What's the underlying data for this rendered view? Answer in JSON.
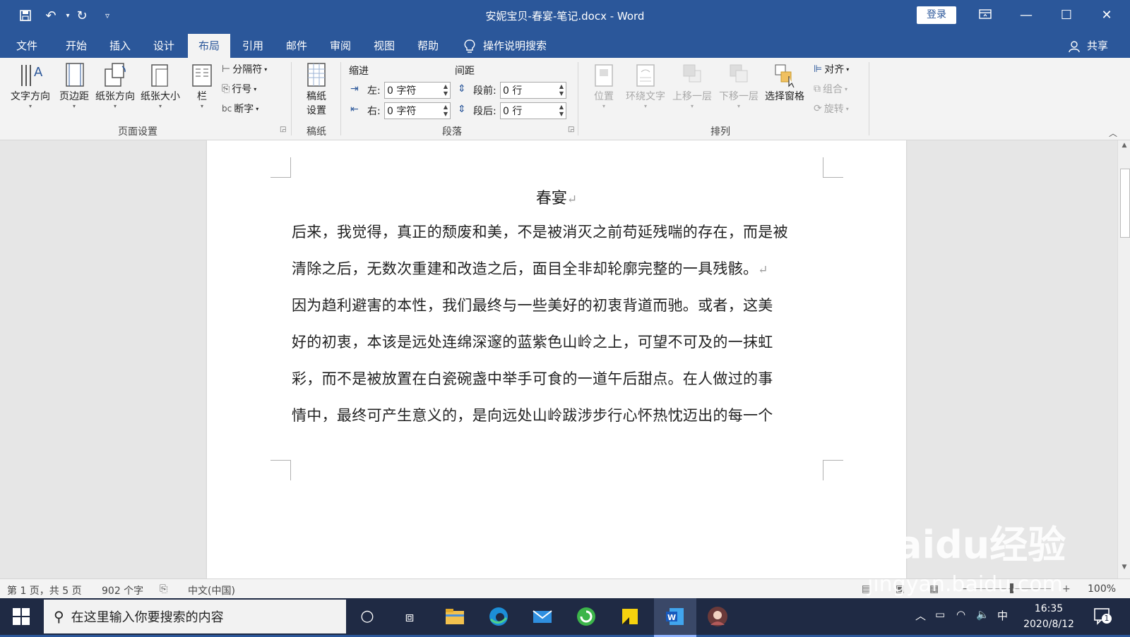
{
  "titlebar": {
    "doc_title": "安妮宝贝-春宴-笔记.docx  -  Word",
    "login_label": "登录"
  },
  "tabs": [
    {
      "label": "文件"
    },
    {
      "label": "开始"
    },
    {
      "label": "插入"
    },
    {
      "label": "设计"
    },
    {
      "label": "布局",
      "active": true
    },
    {
      "label": "引用"
    },
    {
      "label": "邮件"
    },
    {
      "label": "审阅"
    },
    {
      "label": "视图"
    },
    {
      "label": "帮助"
    }
  ],
  "tell_me": "操作说明搜索",
  "share_label": "共享",
  "ribbon": {
    "page_setup": {
      "text_direction": "文字方向",
      "margins": "页边距",
      "orientation": "纸张方向",
      "size": "纸张大小",
      "columns": "栏",
      "breaks": "分隔符",
      "line_numbers": "行号",
      "hyphenation": "断字",
      "group_label": "页面设置"
    },
    "manuscript": {
      "button": "稿纸\n设置",
      "button_line1": "稿纸",
      "button_line2": "设置",
      "group_label": "稿纸"
    },
    "paragraph": {
      "indent_header": "缩进",
      "spacing_header": "间距",
      "left_label": "左:",
      "left_value": "0 字符",
      "right_label": "右:",
      "right_value": "0 字符",
      "before_label": "段前:",
      "before_value": "0 行",
      "after_label": "段后:",
      "after_value": "0 行",
      "group_label": "段落"
    },
    "arrange": {
      "position": "位置",
      "wrap_text": "环绕文字",
      "bring_forward": "上移一层",
      "send_backward": "下移一层",
      "selection_pane": "选择窗格",
      "align": "对齐",
      "group": "组合",
      "rotate": "旋转",
      "group_label": "排列"
    }
  },
  "document": {
    "heading": "春宴",
    "lines": [
      "后来，我觉得，真正的颓废和美，不是被消灭之前苟延残喘的存在，而是被",
      "清除之后，无数次重建和改造之后，面目全非却轮廓完整的一具残骸。",
      "因为趋利避害的本性，我们最终与一些美好的初衷背道而驰。或者，这美",
      "好的初衷，本该是远处连绵深邃的蓝紫色山岭之上，可望不可及的一抹虹",
      "彩，而不是被放置在白瓷碗盏中举手可食的一道午后甜点。在人做过的事",
      "情中，最终可产生意义的，是向远处山岭跋涉步行心怀热忱迈出的每一个"
    ],
    "para_mark": "↵"
  },
  "status": {
    "page": "第 1 页，共 5 页",
    "words": "902 个字",
    "language": "中文(中国)",
    "zoom": "100%"
  },
  "taskbar": {
    "search_placeholder": "在这里输入你要搜索的内容",
    "ime": "中",
    "time": "16:35",
    "date": "2020/8/12",
    "notifications": "1"
  },
  "watermark": {
    "brand": "Baidu经验",
    "url": "jingyan.baidu.com"
  },
  "colors": {
    "word_blue": "#2b579a",
    "ribbon_bg": "#f3f3f3",
    "taskbar_bg": "#1f2a44"
  }
}
